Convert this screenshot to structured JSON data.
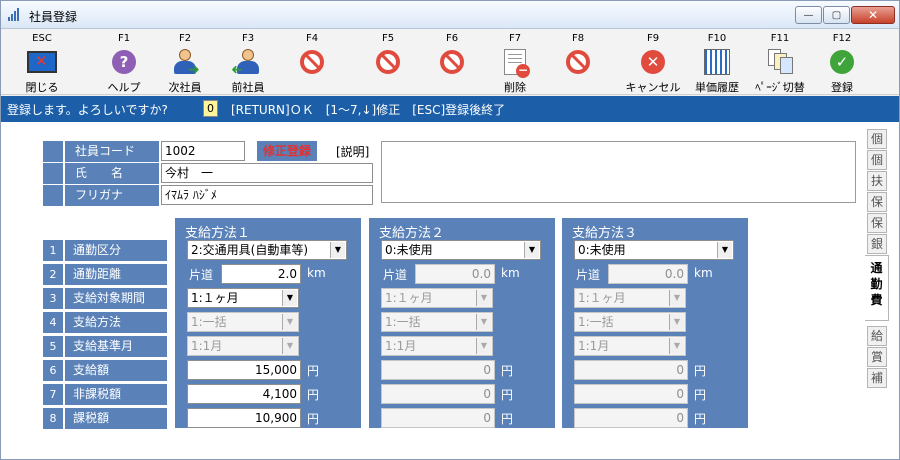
{
  "window": {
    "title": "社員登録",
    "minimize_label": "—",
    "maximize_label": "▢",
    "close_label": "✕"
  },
  "toolbar": {
    "buttons": [
      {
        "key": "ESC",
        "label": "閉じる",
        "icon": "exit-monitor-icon"
      },
      {
        "key": "F1",
        "label": "ヘルプ",
        "icon": "help-icon"
      },
      {
        "key": "F2",
        "label": "次社員",
        "icon": "next-employee-icon"
      },
      {
        "key": "F3",
        "label": "前社員",
        "icon": "previous-employee-icon"
      },
      {
        "key": "F4",
        "label": "",
        "icon": "disabled-icon"
      },
      {
        "key": "F5",
        "label": "",
        "icon": "disabled-icon"
      },
      {
        "key": "F6",
        "label": "",
        "icon": "disabled-icon"
      },
      {
        "key": "F7",
        "label": "削除",
        "icon": "delete-document-icon"
      },
      {
        "key": "F8",
        "label": "",
        "icon": "disabled-icon"
      },
      {
        "key": "F9",
        "label": "キャンセル",
        "icon": "cancel-icon"
      },
      {
        "key": "F10",
        "label": "単価履歴",
        "icon": "price-history-icon"
      },
      {
        "key": "F11",
        "label": "ﾍﾟｰｼﾞ切替",
        "icon": "page-switch-icon"
      },
      {
        "key": "F12",
        "label": "登録",
        "icon": "register-check-icon"
      }
    ]
  },
  "message_bar": {
    "prompt": "登録します。よろしいですか?",
    "input_value": "0",
    "help": "[RETURN]ＯＫ　[1～7,↓]修正　[ESC]登録後終了"
  },
  "employee": {
    "code_label": "社員コード",
    "code_value": "1002",
    "mode_badge": "修正登録",
    "description_label": "[説明]",
    "name_label": "氏　　名",
    "name_value": "今村　一",
    "kana_label": "フリガナ",
    "kana_value": "ｲﾏﾑﾗ ﾊｼﾞﾒ"
  },
  "rows": [
    {
      "num": "1",
      "label": "通勤区分"
    },
    {
      "num": "2",
      "label": "通勤距離"
    },
    {
      "num": "3",
      "label": "支給対象期間"
    },
    {
      "num": "4",
      "label": "支給方法"
    },
    {
      "num": "5",
      "label": "支給基準月"
    },
    {
      "num": "6",
      "label": "支給額"
    },
    {
      "num": "7",
      "label": "非課税額"
    },
    {
      "num": "8",
      "label": "課税額"
    }
  ],
  "methods": [
    {
      "title": "支給方法１",
      "commute_type": "2:交通用具(自動車等)",
      "distance_prefix": "片道",
      "distance": "2.0",
      "distance_unit": "km",
      "period": "1:１ヶ月",
      "pay_method": "1:一括",
      "base_month": "1:1月",
      "amount": "15,000",
      "nontaxable": "4,100",
      "taxable": "10,900",
      "yen": "円"
    },
    {
      "title": "支給方法２",
      "commute_type": "0:未使用",
      "distance_prefix": "片道",
      "distance": "0.0",
      "distance_unit": "km",
      "period": "1:１ヶ月",
      "pay_method": "1:一括",
      "base_month": "1:1月",
      "amount": "0",
      "nontaxable": "0",
      "taxable": "0",
      "yen": "円"
    },
    {
      "title": "支給方法３",
      "commute_type": "0:未使用",
      "distance_prefix": "片道",
      "distance": "0.0",
      "distance_unit": "km",
      "period": "1:１ヶ月",
      "pay_method": "1:一括",
      "base_month": "1:1月",
      "amount": "0",
      "nontaxable": "0",
      "taxable": "0",
      "yen": "円"
    }
  ],
  "side_tabs": {
    "top": [
      "個",
      "個",
      "扶",
      "保",
      "保",
      "銀"
    ],
    "active": "通勤費",
    "bottom": [
      "給",
      "賞",
      "補"
    ]
  }
}
